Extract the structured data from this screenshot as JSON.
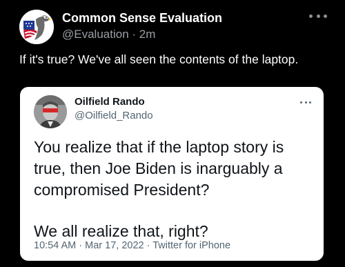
{
  "post": {
    "author_name": "Common Sense Evaluation",
    "handle": "@Evaluation",
    "separator": "·",
    "time_ago": "2m",
    "text": "If it's true? We've all seen the contents of the laptop."
  },
  "quoted_tweet": {
    "author_name": "Oilfield Rando",
    "handle": "@Oilfield_Rando",
    "body_paragraph_1": "You realize that if the laptop story is true, then Joe Biden is inarguably a compromised President?",
    "body_paragraph_2": "We all realize that, right?",
    "meta": "10:54 AM · Mar 17, 2022 · Twitter for iPhone"
  },
  "icons": {
    "post_avatar": "eagle-flag-avatar",
    "quoted_avatar": "redacted-face-avatar",
    "more": "more-options-icon"
  },
  "colors": {
    "background": "#000000",
    "primary_text": "#ffffff",
    "secondary_text": "#9aa0a6",
    "card_background": "#ffffff",
    "card_text": "#0f1419",
    "card_secondary": "#536471"
  }
}
